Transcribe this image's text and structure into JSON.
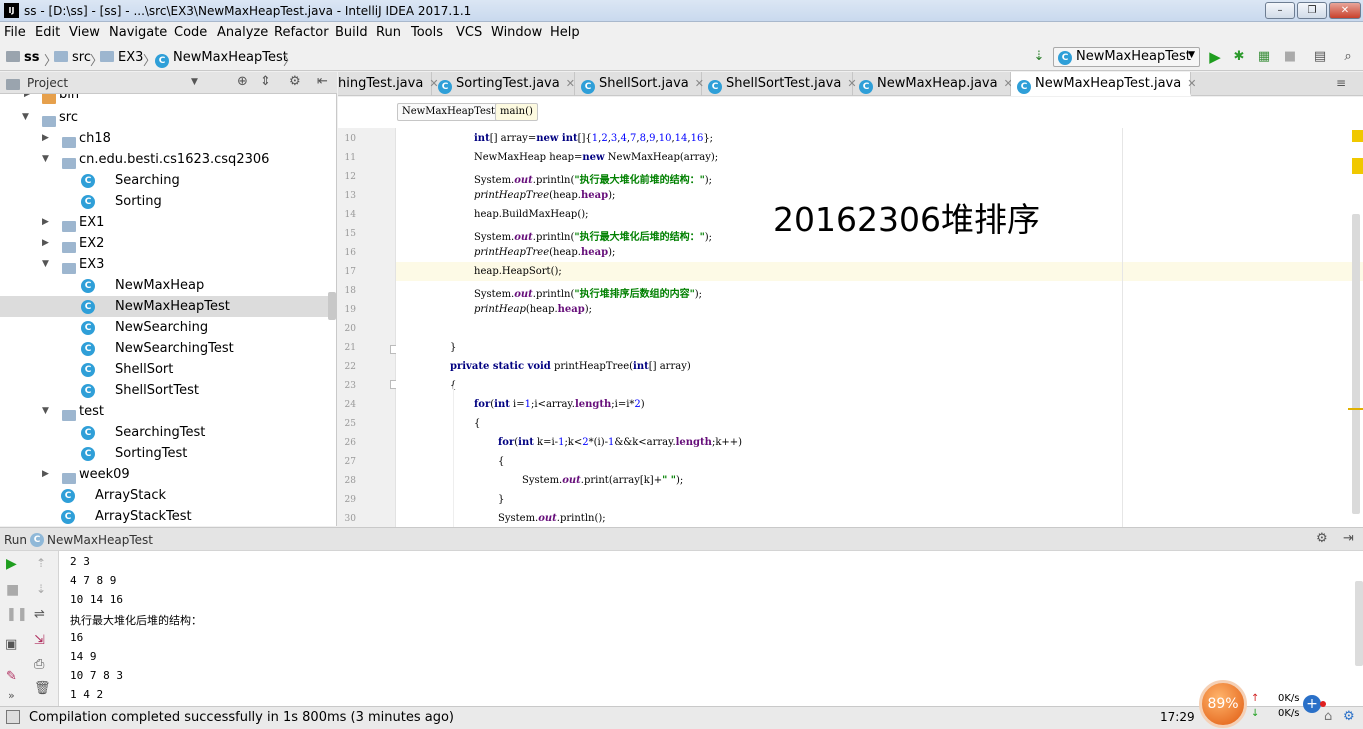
{
  "window": {
    "title": "ss - [D:\\ss] - [ss] - ...\\src\\EX3\\NewMaxHeapTest.java - IntelliJ IDEA 2017.1.1",
    "app_icon": "IJ"
  },
  "menu": [
    "File",
    "Edit",
    "View",
    "Navigate",
    "Code",
    "Analyze",
    "Refactor",
    "Build",
    "Run",
    "Tools",
    "VCS",
    "Window",
    "Help"
  ],
  "breadcrumb": [
    "ss",
    "src",
    "EX3",
    "NewMaxHeapTest"
  ],
  "run_config": "NewMaxHeapTest",
  "project_panel": {
    "title": "Project"
  },
  "tree": [
    {
      "label": "bin",
      "type": "folder-orange"
    },
    {
      "label": "src",
      "type": "folder"
    },
    {
      "label": "ch18",
      "type": "folder"
    },
    {
      "label": "cn.edu.besti.cs1623.csq2306",
      "type": "folder"
    },
    {
      "label": "Searching",
      "type": "class"
    },
    {
      "label": "Sorting",
      "type": "class"
    },
    {
      "label": "EX1",
      "type": "folder"
    },
    {
      "label": "EX2",
      "type": "folder"
    },
    {
      "label": "EX3",
      "type": "folder"
    },
    {
      "label": "NewMaxHeap",
      "type": "class"
    },
    {
      "label": "NewMaxHeapTest",
      "type": "class"
    },
    {
      "label": "NewSearching",
      "type": "class"
    },
    {
      "label": "NewSearchingTest",
      "type": "class"
    },
    {
      "label": "ShellSort",
      "type": "class"
    },
    {
      "label": "ShellSortTest",
      "type": "class"
    },
    {
      "label": "test",
      "type": "folder"
    },
    {
      "label": "SearchingTest",
      "type": "class"
    },
    {
      "label": "SortingTest",
      "type": "class"
    },
    {
      "label": "week09",
      "type": "folder"
    },
    {
      "label": "ArrayStack",
      "type": "class"
    },
    {
      "label": "ArrayStackTest",
      "type": "class"
    }
  ],
  "tabs": [
    "hingTest.java",
    "SortingTest.java",
    "ShellSort.java",
    "ShellSortTest.java",
    "NewMaxHeap.java",
    "NewMaxHeapTest.java"
  ],
  "editor_breadcrumb": [
    "NewMaxHeapTest",
    "main()"
  ],
  "line_numbers": [
    "10",
    "11",
    "12",
    "13",
    "14",
    "15",
    "16",
    "17",
    "18",
    "19",
    "20",
    "21",
    "22",
    "23",
    "24",
    "25",
    "26",
    "27",
    "28",
    "29",
    "30"
  ],
  "overlay_text": "20162306堆排序",
  "run_panel": {
    "title": "Run",
    "config": "NewMaxHeapTest"
  },
  "output_lines": [
    "2 3",
    "4 7 8 9",
    "10 14 16",
    "执行最大堆化后堆的结构：",
    "16",
    "14 9",
    "10 7 8 3",
    "1 4 2"
  ],
  "status": {
    "message": "Compilation completed successfully in 1s 800ms (3 minutes ago)",
    "time": "17:29",
    "widget_percent": "89%",
    "upload": "0K/s",
    "download": "0K/s"
  }
}
